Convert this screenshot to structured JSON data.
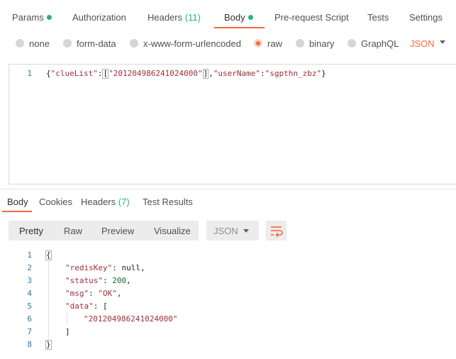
{
  "request_tabs": [
    {
      "label": "Params",
      "dot": true
    },
    {
      "label": "Authorization"
    },
    {
      "label": "Headers",
      "count": "(11)"
    },
    {
      "label": "Body",
      "dot": true,
      "active": true
    },
    {
      "label": "Pre-request Script"
    },
    {
      "label": "Tests"
    },
    {
      "label": "Settings"
    }
  ],
  "body_types": {
    "options": [
      "none",
      "form-data",
      "x-www-form-urlencoded",
      "raw",
      "binary",
      "GraphQL"
    ],
    "selected": "raw",
    "format": "JSON"
  },
  "request_editor": {
    "line_number": "1",
    "tokens": {
      "open": "{",
      "key1": "\"clueList\"",
      "colon1": ":",
      "lbracket": "[",
      "val1": "\"201204986241024000\"",
      "rbracket": "]",
      "comma1": ",",
      "key2": "\"userName\"",
      "colon2": ":",
      "val2": "\"sgpthn_zbz\"",
      "close": "}"
    }
  },
  "response_tabs": [
    {
      "label": "Body",
      "active": true
    },
    {
      "label": "Cookies"
    },
    {
      "label": "Headers",
      "count": "(7)"
    },
    {
      "label": "Test Results"
    }
  ],
  "response_toolbar": {
    "views": [
      "Pretty",
      "Raw",
      "Preview",
      "Visualize"
    ],
    "format": "JSON"
  },
  "response_body": {
    "line_numbers": [
      "1",
      "2",
      "3",
      "4",
      "5",
      "6",
      "7",
      "8"
    ],
    "lines": {
      "l1": "{",
      "l2_key": "\"redisKey\"",
      "l2_sep": ": ",
      "l2_val": "null",
      "l2_end": ",",
      "l3_key": "\"status\"",
      "l3_sep": ": ",
      "l3_val": "200",
      "l3_end": ",",
      "l4_key": "\"msg\"",
      "l4_sep": ": ",
      "l4_val": "\"OK\"",
      "l4_end": ",",
      "l5_key": "\"data\"",
      "l5_sep": ": ",
      "l5_val": "[",
      "l6_val": "\"201204986241024000\"",
      "l7": "]",
      "l8": "}"
    }
  },
  "colors": {
    "accent": "#f26b3a",
    "indicator": "#26b47f",
    "json_key": "#a0303a",
    "line_number": "#2a7aa0"
  },
  "icons": {
    "wrap": "wrap-lines-icon",
    "dropdown": "chevron-down-icon"
  }
}
